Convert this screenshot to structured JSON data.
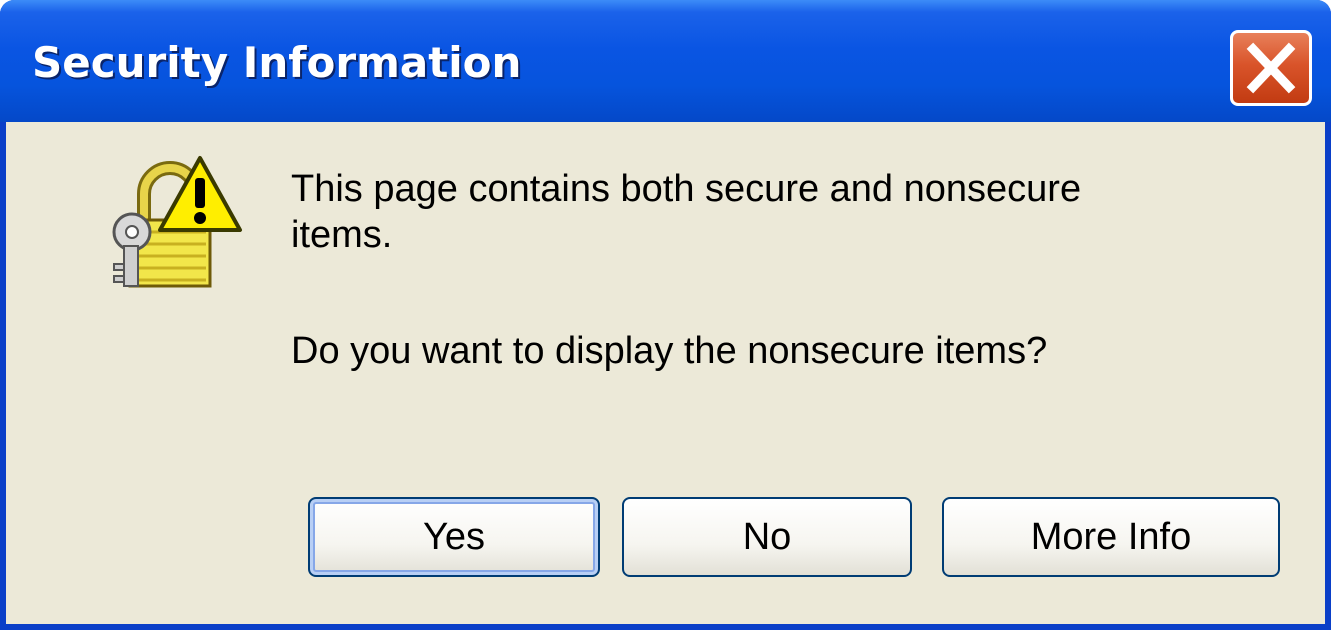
{
  "window": {
    "title": "Security Information",
    "close_icon": "close-x-icon",
    "title_bar_color": "#0a55e3",
    "close_button_color": "#d9542a"
  },
  "dialog": {
    "icon": "padlock-warning-icon",
    "message_line1": "This page contains both secure and nonsecure",
    "message_line2": "items.",
    "question": "Do you want to display the nonsecure items?",
    "background_color": "#ece9d8"
  },
  "buttons": {
    "yes_label": "Yes",
    "no_label": "No",
    "more_info_label": "More Info",
    "default": "Yes"
  }
}
